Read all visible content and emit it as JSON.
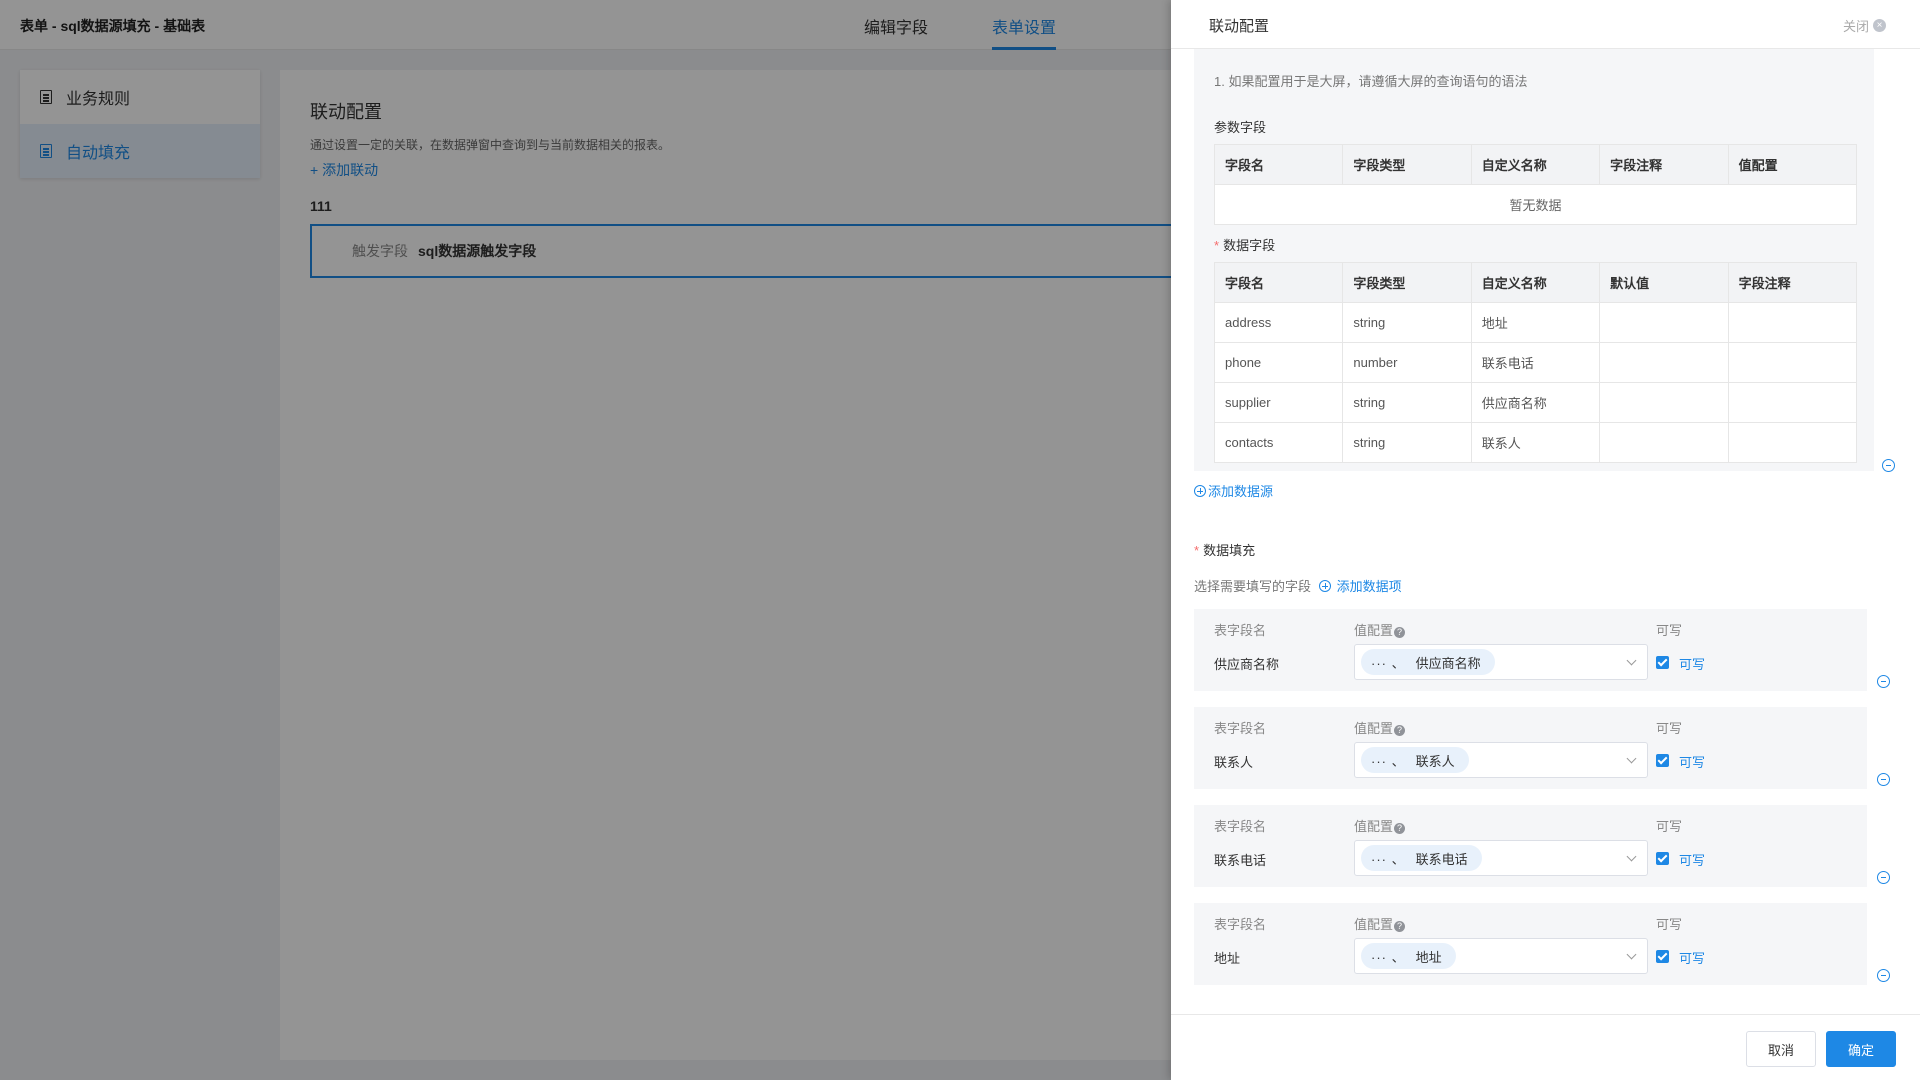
{
  "app": {
    "title": "表单 - sql数据源填充 - 基础表"
  },
  "top_tabs": [
    {
      "label": "编辑字段"
    },
    {
      "label": "表单设置"
    }
  ],
  "sidebar": {
    "items": [
      {
        "label": "业务规则",
        "icon": "document-icon"
      },
      {
        "label": "自动填充",
        "icon": "document-icon"
      }
    ]
  },
  "main": {
    "title": "联动配置",
    "description": "通过设置一定的关联，在数据弹窗中查询到与当前数据相关的报表。",
    "add_link": "+ 添加联动",
    "rule_name": "111",
    "trigger_label": "触发字段",
    "trigger_value": "sql数据源触发字段"
  },
  "drawer": {
    "title": "联动配置",
    "close_label": "关闭",
    "note": "1. 如果配置用于是大屏，请遵循大屏的查询语句的语法",
    "params": {
      "label": "参数字段",
      "columns": [
        "字段名",
        "字段类型",
        "自定义名称",
        "字段注释",
        "值配置"
      ],
      "empty_text": "暂无数据"
    },
    "data_fields": {
      "label": "数据字段",
      "columns": [
        "字段名",
        "字段类型",
        "自定义名称",
        "默认值",
        "字段注释"
      ],
      "rows": [
        [
          "address",
          "string",
          "地址",
          "",
          ""
        ],
        [
          "phone",
          "number",
          "联系电话",
          "",
          ""
        ],
        [
          "supplier",
          "string",
          "供应商名称",
          "",
          ""
        ],
        [
          "contacts",
          "string",
          "联系人",
          "",
          ""
        ]
      ]
    },
    "add_datasource": "添加数据源",
    "fill": {
      "label": "数据填充",
      "hint": "选择需要填写的字段",
      "add_item": "添加数据项",
      "col_field": "表字段名",
      "col_value": "值配置",
      "col_writable": "可写",
      "tag_prefix": "···  、",
      "rows": [
        {
          "name": "供应商名称",
          "value": "供应商名称",
          "writable": "可写"
        },
        {
          "name": "联系人",
          "value": "联系人",
          "writable": "可写"
        },
        {
          "name": "联系电话",
          "value": "联系电话",
          "writable": "可写"
        },
        {
          "name": "地址",
          "value": "地址",
          "writable": "可写"
        }
      ]
    },
    "buttons": {
      "cancel": "取消",
      "ok": "确定"
    }
  },
  "colors": {
    "accent": "#1e88e5",
    "required": "#f56c6c"
  }
}
